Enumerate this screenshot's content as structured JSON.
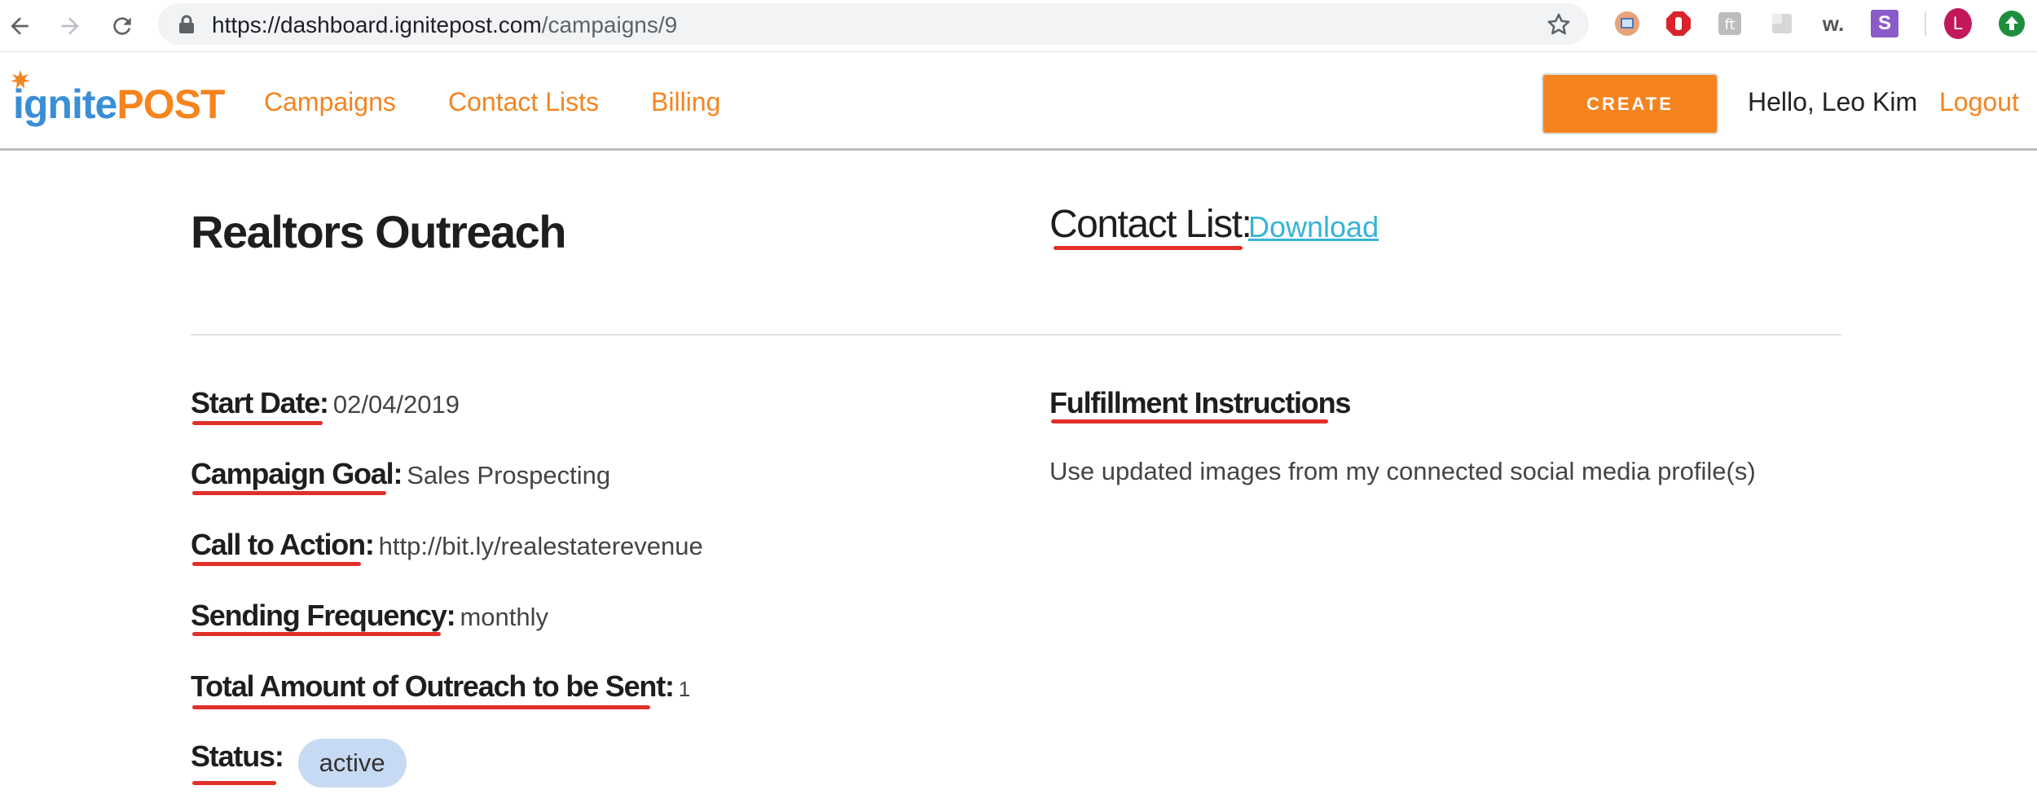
{
  "browser": {
    "url_host": "https://dashboard.ignitepost.com",
    "url_path": "/campaigns/9",
    "profile_initial": "L",
    "extension_w_label": "w.",
    "extension_s_label": "S"
  },
  "header": {
    "logo_ignite": "ignite",
    "logo_post": "POST",
    "nav": [
      "Campaigns",
      "Contact Lists",
      "Billing"
    ],
    "create_label": "CREATE",
    "greeting": "Hello, Leo Kim",
    "logout_label": "Logout"
  },
  "campaign": {
    "title": "Realtors Outreach",
    "contact_list_label": "Contact List:",
    "download_label": "Download",
    "fields": [
      {
        "label": "Start Date:",
        "value": "02/04/2019"
      },
      {
        "label": "Campaign Goal:",
        "value": "Sales Prospecting"
      },
      {
        "label": "Call to Action:",
        "value": "http://bit.ly/realestaterevenue"
      },
      {
        "label": "Sending Frequency:",
        "value": "monthly"
      },
      {
        "label": "Total Amount of Outreach to be Sent:",
        "value": "1"
      }
    ],
    "status_label": "Status:",
    "status_value": "active",
    "fulfillment_label": "Fulfillment Instructions",
    "fulfillment_text": "Use updated images from my connected social media profile(s)"
  },
  "colors": {
    "brand_orange": "#f5841f",
    "brand_blue": "#3a8ed6",
    "link_cyan": "#36b3d6",
    "annotation_red": "#e0302a",
    "status_pill": "#c7daf3"
  }
}
